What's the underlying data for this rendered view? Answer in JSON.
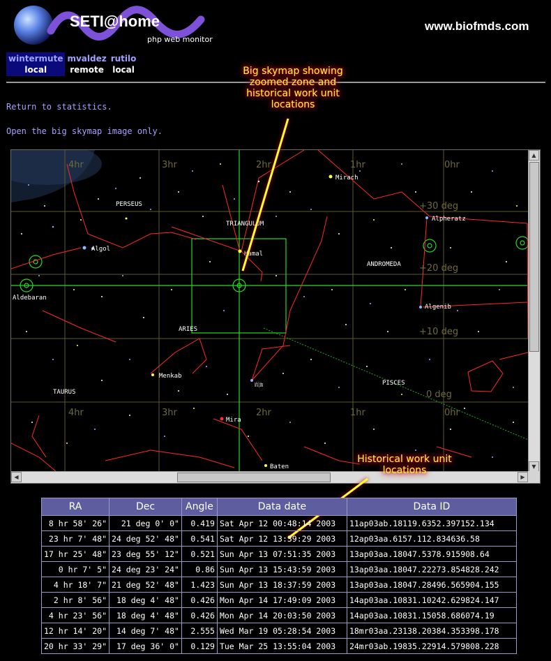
{
  "header": {
    "app_title": "SETI@home",
    "subtitle": "php web monitor",
    "site_url": "www.biofmds.com"
  },
  "hosts": [
    {
      "name": "wintermute",
      "location": "local",
      "active": true
    },
    {
      "name": "mvaldez",
      "location": "remote",
      "active": false
    },
    {
      "name": "rutilo",
      "location": "local",
      "active": false
    }
  ],
  "links": {
    "return_stats": "Return to statistics.",
    "big_skymap": "Open the big skymap image only."
  },
  "skymap": {
    "ra_labels": [
      "4hr",
      "3hr",
      "2hr",
      "1hr",
      "0hr"
    ],
    "dec_labels": [
      "+30 deg",
      "+20 deg",
      "+10 deg",
      "0 deg"
    ],
    "constellations": [
      "PERSEUS",
      "TRIANGULUM",
      "ANDROMEDA",
      "ARIES",
      "PISCES",
      "TAURUS"
    ],
    "stars": [
      "Mirach",
      "Alpheratz",
      "Algenib",
      "Aldebaran",
      "Hamal",
      "Menkab",
      "Kaffaljidhma",
      "Mira",
      "Baten",
      "Algol"
    ],
    "colors": {
      "grid": "#5e5a2a",
      "constellation": "#ff2828",
      "current_zone": "#22dd22",
      "ecliptic": "#22aa22"
    }
  },
  "annotations": {
    "skymap_note": [
      "Big skymap showing",
      "zoomed zone and",
      "historical work unit",
      "locations"
    ],
    "history_note": [
      "Historical work unit",
      "locations"
    ]
  },
  "table": {
    "headers": [
      "RA",
      "Dec",
      "Angle",
      "Data date",
      "Data ID"
    ],
    "rows": [
      [
        "8 hr 58' 26\"",
        "21 deg 0' 0\"",
        "0.419",
        "Sat Apr 12 00:48:14 2003",
        "11ap03ab.18119.6352.397152.134"
      ],
      [
        "23 hr 7' 48\"",
        "24 deg 52' 48\"",
        "0.541",
        "Sat Apr 12 13:39:29 2003",
        "12ap03aa.6157.112.834636.58"
      ],
      [
        "17 hr 25' 48\"",
        "23 deg 55' 12\"",
        "0.521",
        "Sun Apr 13 07:51:35 2003",
        "13ap03aa.18047.5378.915908.64"
      ],
      [
        "0 hr 7' 5\"",
        "24 deg 23' 24\"",
        "0.86",
        "Sun Apr 13 15:43:59 2003",
        "13ap03aa.18047.22273.854828.242"
      ],
      [
        "4 hr 18' 7\"",
        "21 deg 52' 48\"",
        "1.423",
        "Sun Apr 13 18:37:59 2003",
        "13ap03aa.18047.28496.565904.155"
      ],
      [
        "2 hr 8' 56\"",
        "18 deg 4' 48\"",
        "0.426",
        "Mon Apr 14 17:49:09 2003",
        "14ap03aa.10831.10242.629824.147"
      ],
      [
        "4 hr 23' 56\"",
        "18 deg 4' 48\"",
        "0.426",
        "Mon Apr 14 20:03:50 2003",
        "14ap03aa.10831.15058.686074.19"
      ],
      [
        "12 hr 14' 20\"",
        "14 deg 7' 48\"",
        "2.555",
        "Wed Mar 19 05:28:54 2003",
        "18mr03aa.23138.20384.353398.178"
      ],
      [
        "20 hr 33' 29\"",
        "17 deg 36' 0\"",
        "0.129",
        "Tue Mar 25 13:55:04 2003",
        "24mr03ab.19835.22914.579808.228"
      ]
    ]
  }
}
